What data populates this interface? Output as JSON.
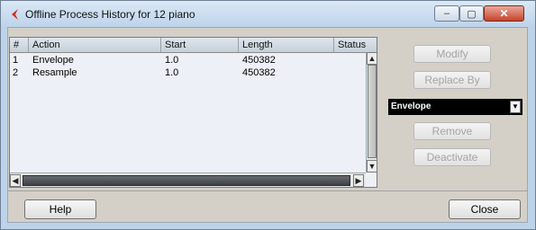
{
  "window": {
    "title": "Offline Process History for 12 piano",
    "caption": {
      "minimize": "‒",
      "maximize": "▢",
      "close": "✕"
    }
  },
  "table": {
    "columns": [
      "#",
      "Action",
      "Start",
      "Length",
      "Status"
    ],
    "rows": [
      {
        "num": "1",
        "action": "Envelope",
        "start": "1.0",
        "length": "450382",
        "status": ""
      },
      {
        "num": "2",
        "action": "Resample",
        "start": "1.0",
        "length": "450382",
        "status": ""
      }
    ]
  },
  "scroll": {
    "up": "▲",
    "down": "▼",
    "left": "◀",
    "right": "▶"
  },
  "side": {
    "modify": "Modify",
    "replace_by": "Replace By",
    "dropdown_value": "Envelope",
    "dropdown_arrow": "▼",
    "remove": "Remove",
    "deactivate": "Deactivate"
  },
  "footer": {
    "help": "Help",
    "close": "Close"
  },
  "colors": {
    "title_bg": "#bcd2ea",
    "dialog_bg": "#d4d0c8",
    "close_btn": "#c6432b",
    "disabled_text": "#a4a4a4"
  }
}
